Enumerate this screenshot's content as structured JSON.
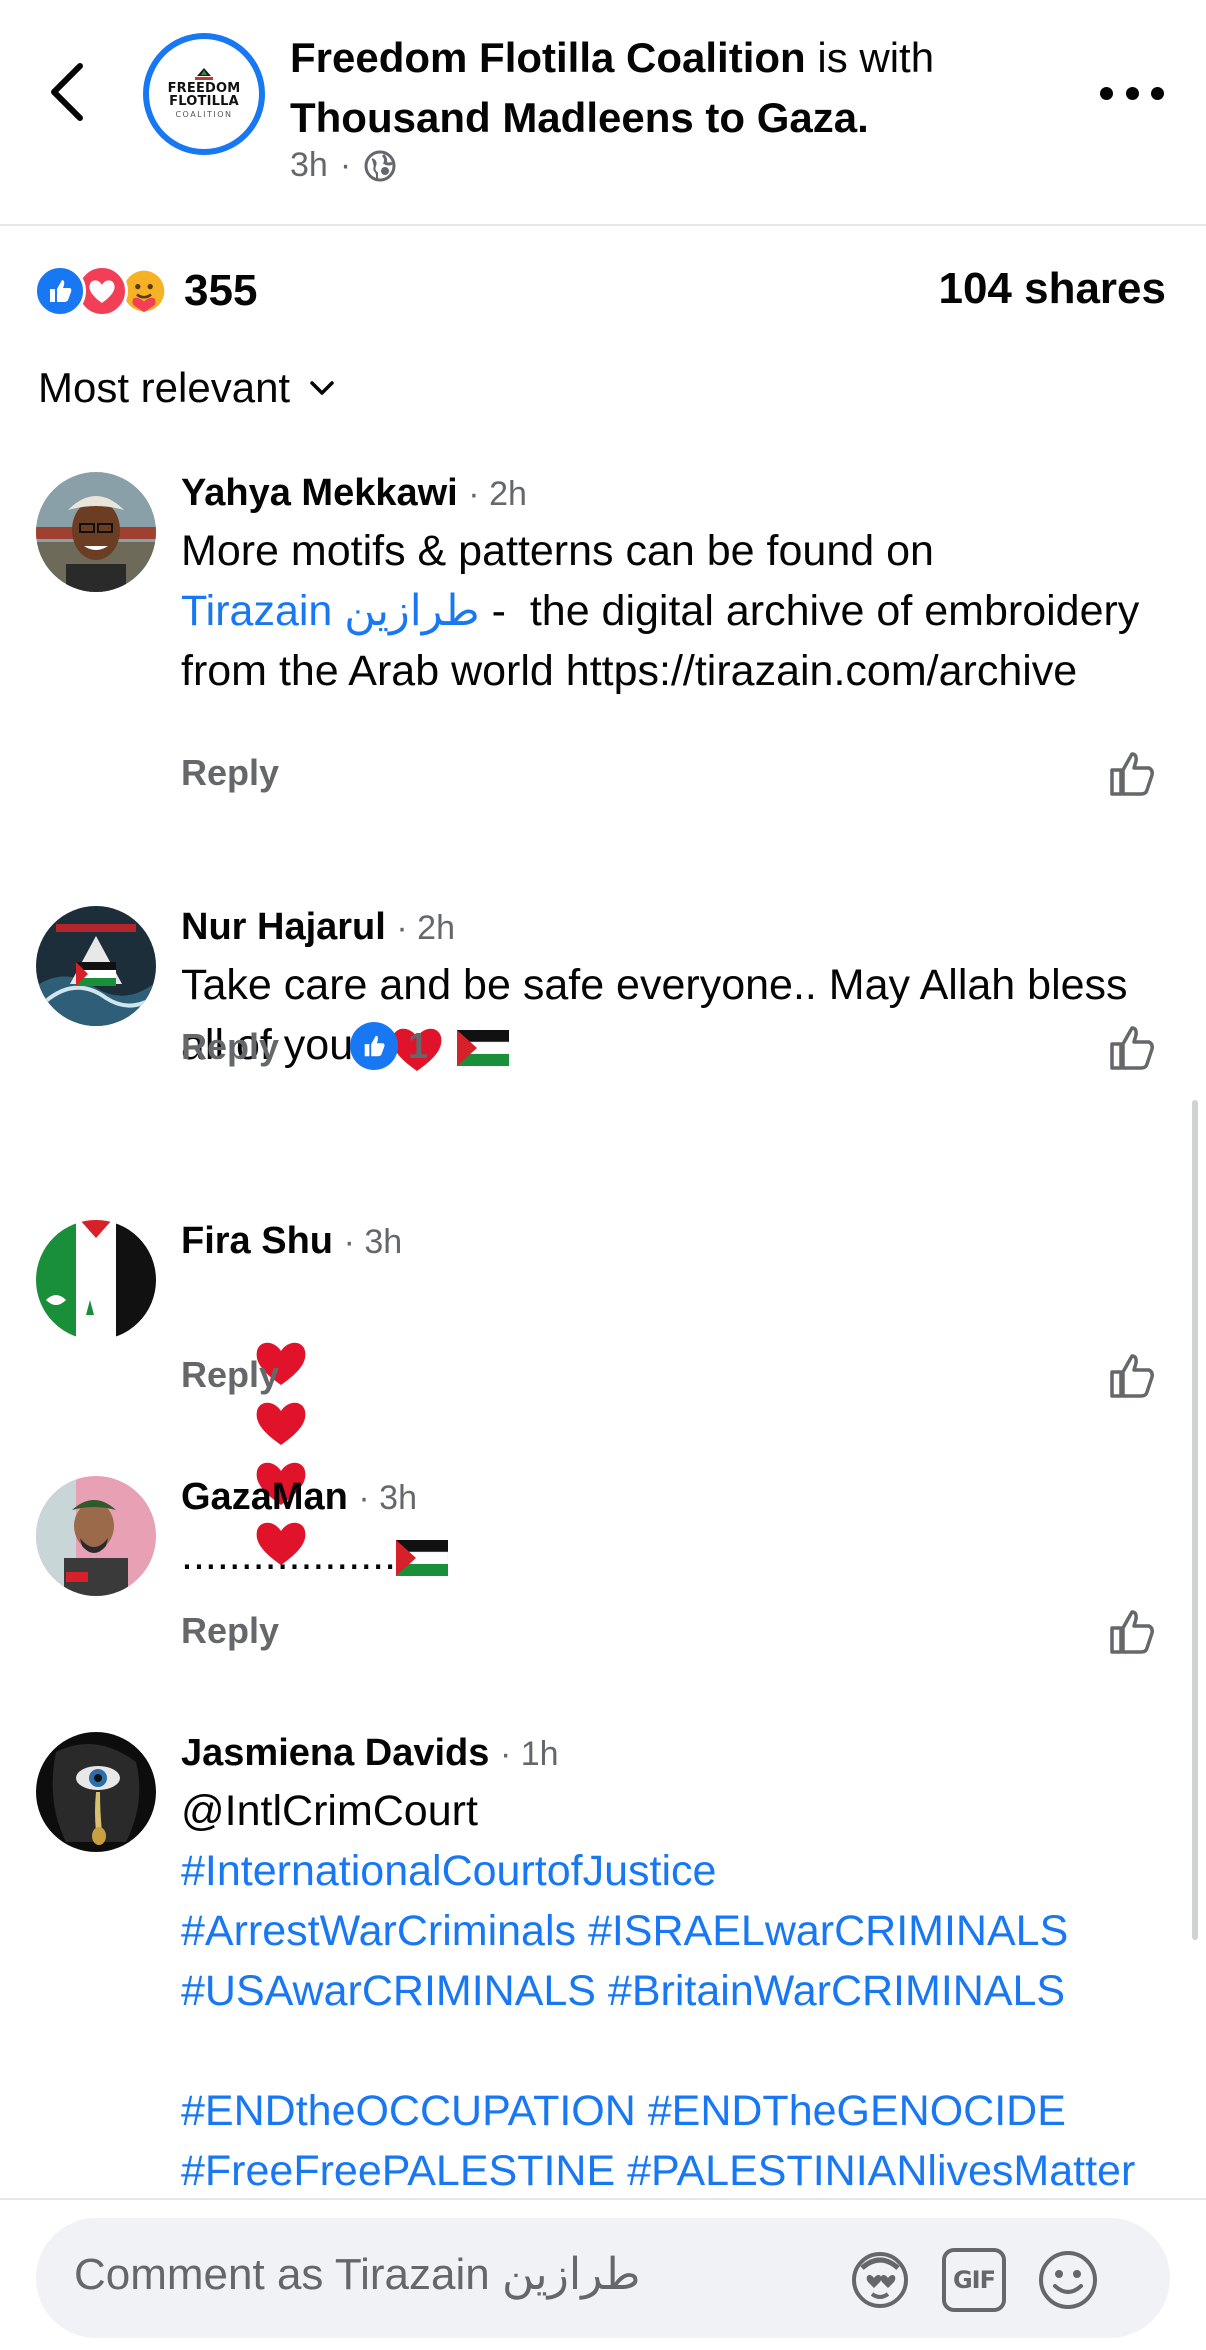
{
  "header": {
    "author": "Freedom Flotilla Coalition",
    "with_text": "is with",
    "tagged": "Thousand Madleens to Gaza.",
    "time": "3h",
    "separator": "·",
    "avatar_logo": {
      "line1": "FREEDOM",
      "line2": "FLOTILLA",
      "line3": "COALITION"
    }
  },
  "stats": {
    "reaction_count": "355",
    "shares": "104 shares",
    "reaction_types": [
      "like",
      "love",
      "care"
    ]
  },
  "sort": {
    "label": "Most relevant"
  },
  "comments": [
    {
      "name": "Yahya Mekkawi",
      "time": "· 2h",
      "text_pre": "More motifs & patterns can be found on",
      "mention": "Tirazain طرازين",
      "text_post": " -  the digital archive of embroidery from the Arab world https://tirazain.com/archive",
      "reply": "Reply"
    },
    {
      "name": "Nur Hajarul",
      "time": "· 2h",
      "text": "Take care and be safe everyone.. May Allah bless all of you..",
      "reply": "Reply",
      "like_count": "1"
    },
    {
      "name": "Fira Shu",
      "time": "· 3h",
      "reply": "Reply"
    },
    {
      "name": "GazaMan",
      "time": "· 3h",
      "text": "..................",
      "reply": "Reply"
    },
    {
      "name": "Jasmiena Davids",
      "time": "· 1h",
      "mention": "@IntlCrimCourt",
      "hashtags_1": "#InternationalCourtofJustice",
      "hashtags_2": "#ArrestWarCriminals #ISRAELwarCRIMINALS",
      "hashtags_3": "#USAwarCRIMINALS #BritainWarCRIMINALS",
      "hashtags_4": "#ENDtheOCCUPATION #ENDTheGENOCIDE",
      "hashtags_5": "#FreeFreePALESTINE #PALESTINIANlivesMatter"
    }
  ],
  "composer": {
    "placeholder": "Comment as Tirazain طرازين",
    "icons": [
      "avatar-sticker-icon",
      "gif-icon",
      "emoji-icon"
    ],
    "gif_label": "GIF"
  },
  "colors": {
    "link": "#1877f2",
    "secondary_text": "#65676b",
    "divider": "#e4e6eb"
  }
}
